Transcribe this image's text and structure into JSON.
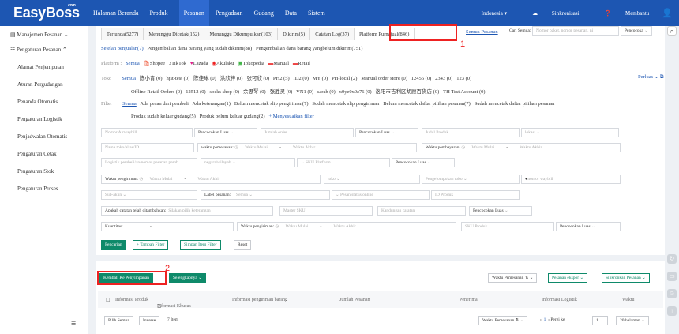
{
  "app": {
    "logo": "EasyBoss",
    "logo_sup": ".com"
  },
  "nav": {
    "items": [
      "Halaman Beranda",
      "Produk",
      "Pesanan",
      "Pengadaan",
      "Gudang",
      "Data",
      "Sistem"
    ],
    "active": "Pesanan"
  },
  "topright": {
    "country": "Indonesia",
    "sync": "Sinkronisasi",
    "help": "Membantu"
  },
  "sidebar": {
    "group1": "Manajemen Pesanan",
    "group2": "Pengaturan Pesanan",
    "items": [
      "Alamat Penjemputan",
      "Aturan Pergudangan",
      "Penanda Otomatis",
      "Pengaturan Logistik",
      "Penjadwalan Otomatis",
      "Pengaturan Cetak",
      "Pengaturan Stok",
      "Pengaturan Proses"
    ]
  },
  "tabs": [
    "Tertunda(5277)",
    "Menunggu Dicetak(152)",
    "Menunggu Dikumpulkan(103)",
    "Dikirim(5)",
    "Catatan Log(37)",
    "Platform Purnajual(846)"
  ],
  "search": {
    "link": "Semua Pesanan",
    "label": "Cari Semua:",
    "placeholder": "Nomor paket, nomor pesanan, ni",
    "match": "Pencocoka"
  },
  "subtabs": [
    "Setelah penjualan(7)",
    "Pengembalian dana barang yang sudah dikirim(88)",
    "Pengembalian dana barang yangbelum dikirim(751)"
  ],
  "platform": {
    "label": "Platform :",
    "items": [
      "Semua",
      "Shopee",
      "TikTok",
      "Lazada",
      "Akulaku",
      "Tokopedia",
      "Manual",
      "Retail"
    ]
  },
  "toko": {
    "label": "Toko",
    "line1": [
      "Semua",
      "陈小青 (0)",
      "hjst-test (0)",
      "陈佳琳 (0)",
      "洪欣梓 (0)",
      "张可欣 (0)",
      "PH2 (5)",
      "ID2 (0)",
      "MY (0)",
      "PH-local (2)",
      "Manual order store (0)",
      "12456 (0)",
      "2343 (0)",
      "123 (0)"
    ],
    "line2": [
      "Offline Retail Orders (0)",
      "12512 (0)",
      "socks shop (0)",
      "余思琴 (0)",
      "张胜灵 (0)",
      "VN1 (0)",
      "sarah (0)",
      "x0ye0x9z76 (0)",
      "洛阳市吉利区胡顾百货店 (0)",
      "TH Test Account (0)"
    ],
    "more": "Perluas"
  },
  "filter": {
    "label": "Filter",
    "line1": [
      "Semua",
      "Ada pesan dari pembeli",
      "Ada keterangan(1)",
      "Belum mencetak slip pengiriman(7)",
      "Sudah mencetak slip pengiriman",
      "Belum mencetak daftar pilihan pesanan(7)",
      "Sudah mencetak daftar pilihan pesanan"
    ],
    "line2": [
      "Produk sudah keluar gudang(5)",
      "Produk belum keluar gudang(2)"
    ],
    "custom": "+ Menyesuaikan filter"
  },
  "form": {
    "r1": [
      "Nomor Airwaybill",
      "Pencocokan Luas",
      "Jumlah order",
      "Pencocokan Luas",
      "Judul Produk",
      "lokasi"
    ],
    "r2": [
      "Nama toko/alias/ID",
      "waktu pemesanan:",
      "Waktu Mulai",
      "-",
      "Waktu Akhir",
      "Waktu pembayaran:",
      "Waktu Mulai",
      "-",
      "Waktu Akhir"
    ],
    "r3": [
      "Logistik pembeli/an/nomor pesanan pemb",
      "negara/wilayah",
      "SKU Platform",
      "Pencocokan Luas"
    ],
    "r4": [
      "Waktu pengiriman:",
      "Waktu Mulai",
      "-",
      "Waktu Akhir",
      "toko",
      "Pengelompokan toko",
      "nomor waybill"
    ],
    "r5": [
      "Sub-akun",
      "Label pesanan:",
      "Semua",
      "Pesan status online",
      "ID Produk"
    ],
    "r6": [
      "Apakah catatan telah ditambahkan:",
      "Silakan pilih keterangan",
      "Master SKU",
      "Kandungan catatan",
      "Pencocokan Luas"
    ],
    "r7": [
      "Kuantitas:",
      "-",
      "Waktu pengiriman:",
      "Waktu Mulai",
      "-",
      "Waktu Akhir",
      "SKU Produk",
      "Pencocokan Luas"
    ]
  },
  "buttons": {
    "search": "Pencarian",
    "add": "+ Tambah Filter",
    "save": "Simpan Item Filter",
    "reset": "Reset"
  },
  "actions": {
    "back": "Kembali Ke Penyimpanan",
    "more": "Selengkapnya",
    "sort": "Waktu Pemesanan",
    "export": "Pesanan ekspor",
    "sync": "Sinkronkan Pesanan"
  },
  "table": {
    "cols": [
      "Informasi Produk",
      "Informasi Khusus",
      "Informasi pengiriman barang",
      "Jumlah Pesanan",
      "Penerima",
      "Informasi Logistik",
      "Waktu"
    ]
  },
  "pager": {
    "all": "Pilih Semua",
    "inverse": "Inverse",
    "count": "7 Item",
    "sort": "Waktu Pemesanan",
    "page": "1",
    "goto": "Pergi ke",
    "goto_val": "1",
    "size": "20/halaman"
  },
  "markers": {
    "one": "1",
    "two": "2"
  }
}
